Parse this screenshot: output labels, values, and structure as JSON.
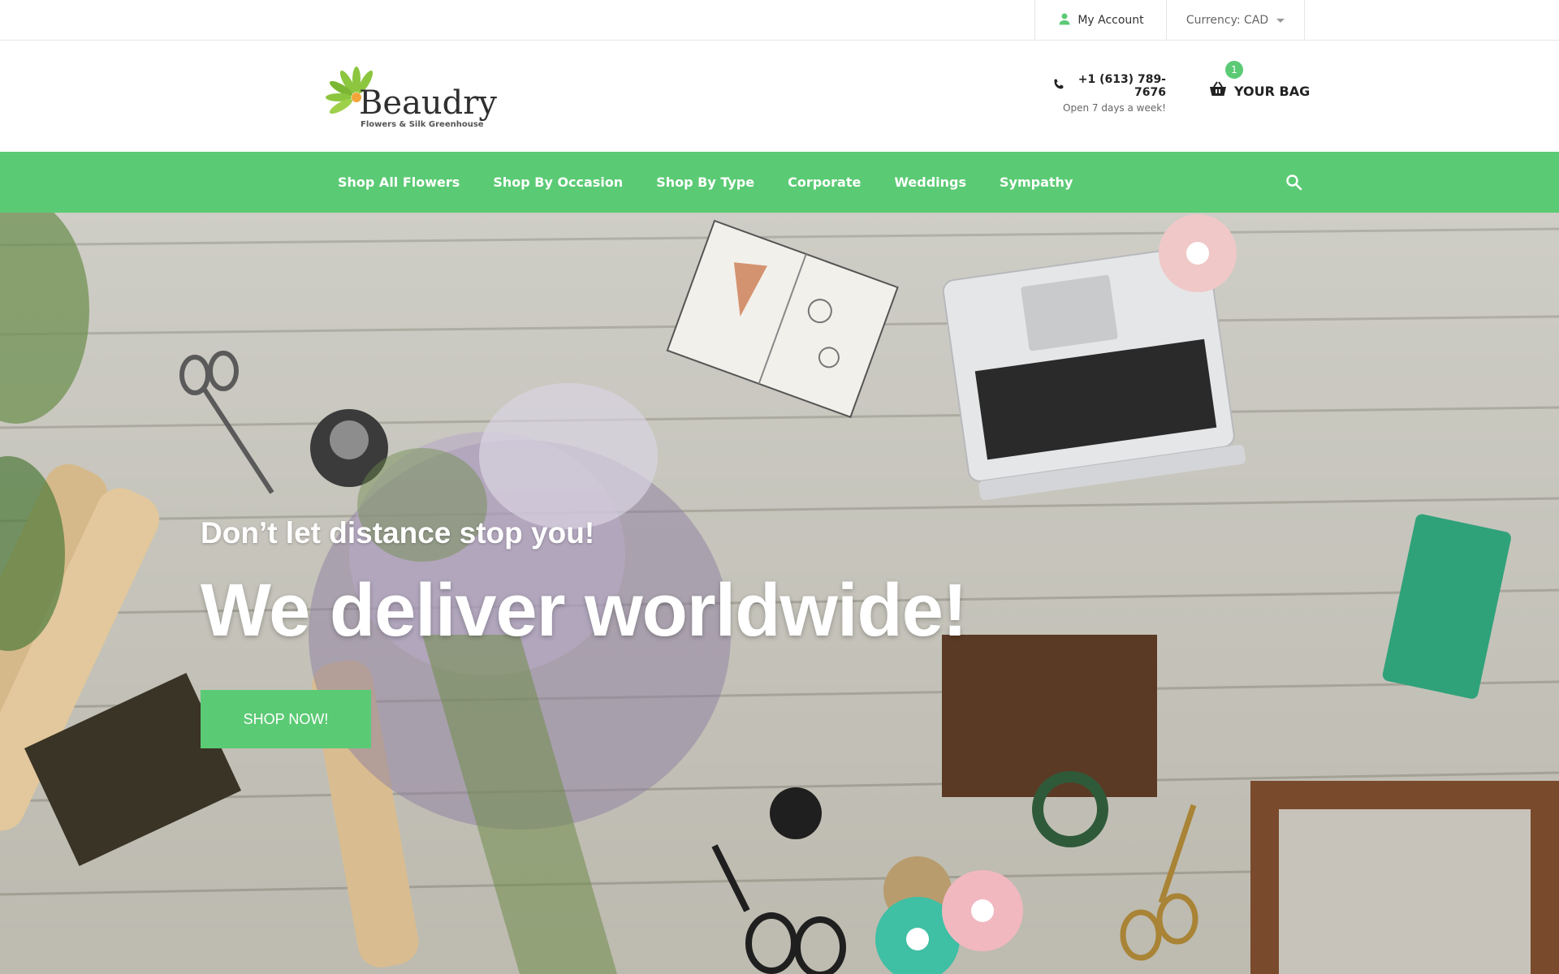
{
  "topbar": {
    "account_label": "My Account",
    "currency_label": "Currency: CAD",
    "account_icon": "user-icon",
    "currency_icon": "caret-down-icon"
  },
  "header": {
    "logo": {
      "name": "Beaudry",
      "tagline": "Flowers & Silk Greenhouse"
    },
    "phone": "+1 (613) 789-7676",
    "phone_note": "Open 7 days a week!",
    "phone_icon": "phone-icon",
    "bag": {
      "label": "YOUR BAG",
      "count": "1",
      "icon": "shopping-basket-icon"
    }
  },
  "nav": {
    "items": [
      {
        "label": "Shop All Flowers"
      },
      {
        "label": "Shop By Occasion"
      },
      {
        "label": "Shop By Type"
      },
      {
        "label": "Corporate"
      },
      {
        "label": "Weddings"
      },
      {
        "label": "Sympathy"
      }
    ],
    "search_icon": "search-icon"
  },
  "hero": {
    "subtitle": "Don’t let distance stop you!",
    "title": "We deliver worldwide!",
    "button_label": "SHOP NOW!"
  },
  "colors": {
    "accent": "#5bca74",
    "text_dark": "#222222",
    "text_muted": "#666666",
    "border": "#e6e6e6"
  }
}
